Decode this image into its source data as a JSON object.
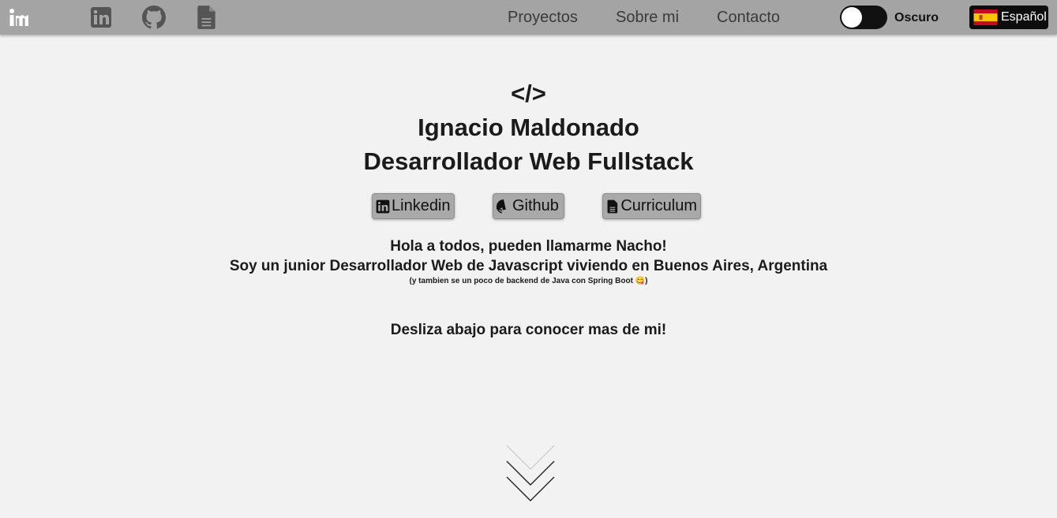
{
  "navbar": {
    "logo": "im",
    "icons": [
      "linkedin-icon",
      "github-icon",
      "document-icon"
    ],
    "links": [
      "Proyectos",
      "Sobre mi",
      "Contacto"
    ],
    "theme_toggle_label": "Oscuro",
    "language_label": "Español",
    "background_color": "#a4a4a4"
  },
  "hero": {
    "code_symbol": "</>",
    "name": "Ignacio Maldonado",
    "role": "Desarrollador Web Fullstack",
    "buttons": [
      {
        "label": "Linkedin",
        "icon": "linkedin-icon"
      },
      {
        "label": "Github",
        "icon": "github-icon"
      },
      {
        "label": "Curriculum",
        "icon": "document-icon"
      }
    ],
    "greeting_line1": "Hola a todos, pueden llamarme Nacho!",
    "greeting_line2": "Soy un junior Desarrollador Web de Javascript viviendo en Buenos Aires, Argentina",
    "greeting_small": "(y tambien se un poco de backend de Java con Spring Boot 😋)",
    "scroll_prompt": "Desliza abajo para conocer mas de mi!",
    "scroll_icon": "chevron-down-icon"
  }
}
